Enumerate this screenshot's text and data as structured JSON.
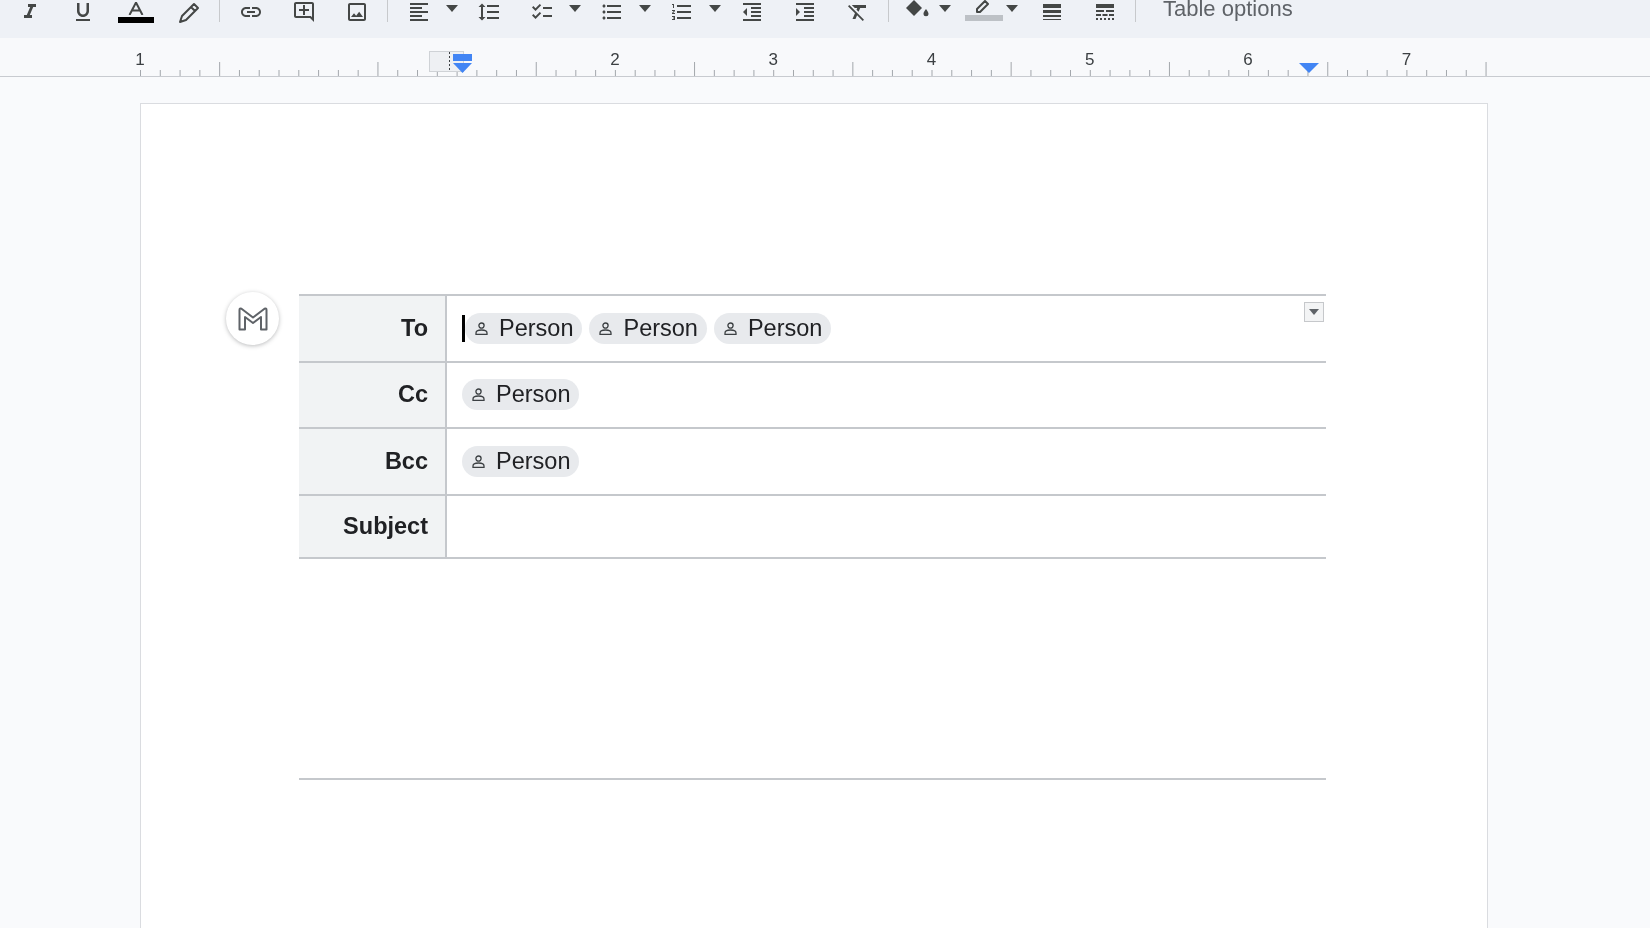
{
  "toolbar": {
    "swatches": [
      {
        "color": "#000000"
      },
      {
        "color": "#bdc1c6"
      }
    ],
    "table_options": "Table options"
  },
  "ruler": {
    "labels": [
      "1",
      "2",
      "3",
      "4",
      "5",
      "6",
      "7"
    ]
  },
  "email_draft": {
    "fields": [
      {
        "label": "To",
        "kind": "recipients",
        "focused": true,
        "dropdown": true,
        "recipients": [
          "Person",
          "Person",
          "Person"
        ]
      },
      {
        "label": "Cc",
        "kind": "recipients",
        "focused": false,
        "dropdown": false,
        "recipients": [
          "Person"
        ]
      },
      {
        "label": "Bcc",
        "kind": "recipients",
        "focused": false,
        "dropdown": false,
        "recipients": [
          "Person"
        ]
      },
      {
        "label": "Subject",
        "kind": "subject",
        "focused": false,
        "dropdown": false
      }
    ]
  }
}
